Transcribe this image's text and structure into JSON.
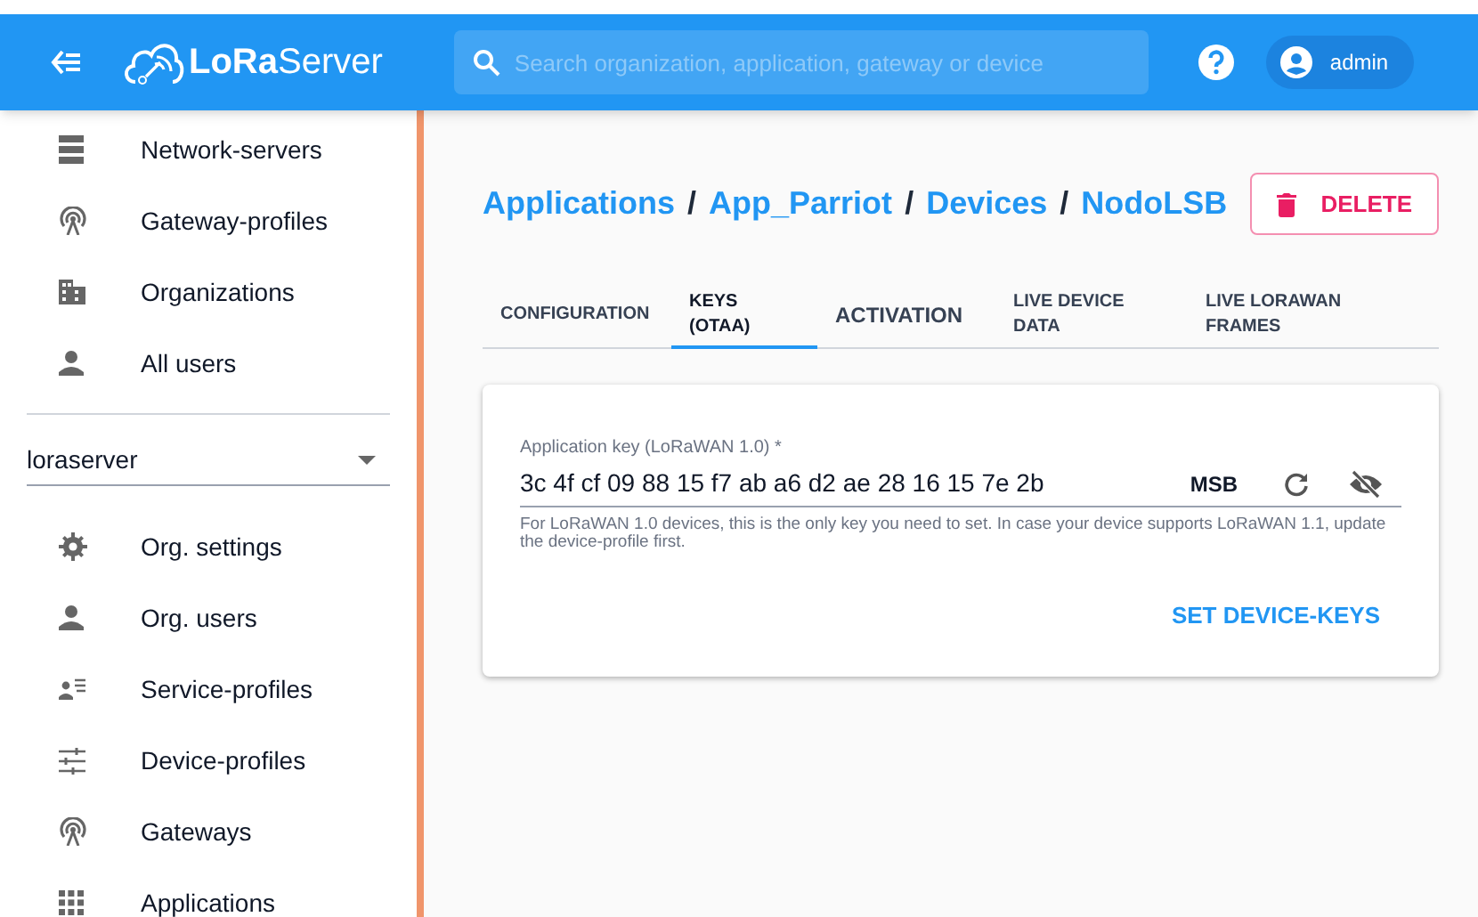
{
  "header": {
    "logo": "LoRaServer",
    "search": {
      "placeholder": "Search organization, application, gateway or device"
    },
    "user": "admin"
  },
  "sidebar": {
    "top_items": [
      {
        "label": "Network-servers"
      },
      {
        "label": "Gateway-profiles"
      },
      {
        "label": "Organizations"
      },
      {
        "label": "All users"
      }
    ],
    "organization_select": "loraserver",
    "org_items": [
      {
        "label": "Org. settings"
      },
      {
        "label": "Org. users"
      },
      {
        "label": "Service-profiles"
      },
      {
        "label": "Device-profiles"
      },
      {
        "label": "Gateways"
      },
      {
        "label": "Applications"
      }
    ]
  },
  "breadcrumb": [
    "Applications",
    "App_Parriot",
    "Devices",
    "NodoLSB"
  ],
  "breadcrumb_separator": "/",
  "delete_button": "DELETE",
  "tabs": [
    {
      "label": "CONFIGURATION",
      "selected": false
    },
    {
      "label": "KEYS (OTAA)",
      "selected": true
    },
    {
      "label": "ACTIVATION",
      "selected": false
    },
    {
      "label": "LIVE DEVICE DATA",
      "selected": false
    },
    {
      "label": "LIVE LORAWAN FRAMES",
      "selected": false
    }
  ],
  "key_field": {
    "label": "Application key (LoRaWAN 1.0) *",
    "value": "3c 4f cf 09 88 15 f7 ab a6 d2 ae 28 16 15 7e 2b",
    "byte_order": "MSB",
    "helper": "For LoRaWAN 1.0 devices, this is the only key you need to set. In case your device supports LoRaWAN 1.1, update the device-profile first."
  },
  "submit_button": "SET DEVICE-KEYS"
}
